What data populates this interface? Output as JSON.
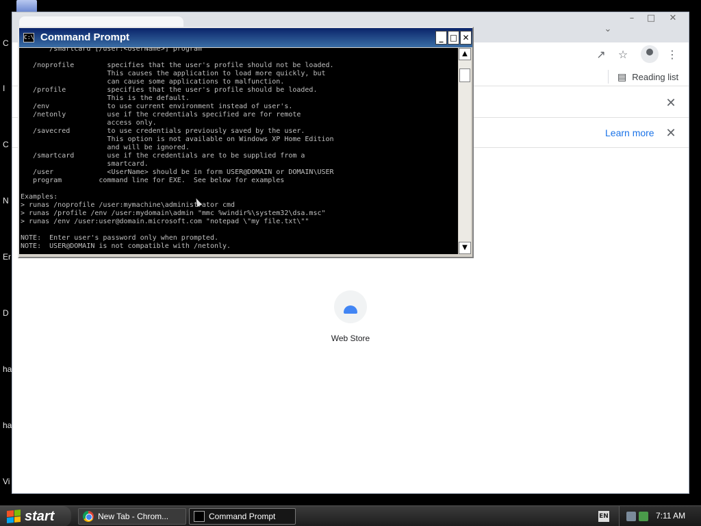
{
  "desktop": {
    "side_letters": [
      "C",
      "I",
      "C",
      "N",
      "Er",
      "D",
      "ha",
      "ha",
      "Vi"
    ]
  },
  "chrome": {
    "reading_list_label": "Reading list",
    "learn_more_label": "Learn more",
    "shortcut_label": "Web Store"
  },
  "cmd": {
    "title": "Command Prompt",
    "sys_icon": "C:\\",
    "lines": [
      "       /smartcard [/user:<UserName>] program",
      "",
      "   /noprofile        specifies that the user's profile should not be loaded.",
      "                     This causes the application to load more quickly, but",
      "                     can cause some applications to malfunction.",
      "   /profile          specifies that the user's profile should be loaded.",
      "                     This is the default.",
      "   /env              to use current environment instead of user's.",
      "   /netonly          use if the credentials specified are for remote",
      "                     access only.",
      "   /savecred         to use credentials previously saved by the user.",
      "                     This option is not available on Windows XP Home Edition",
      "                     and will be ignored.",
      "   /smartcard        use if the credentials are to be supplied from a",
      "                     smartcard.",
      "   /user             <UserName> should be in form USER@DOMAIN or DOMAIN\\USER",
      "   program         command line for EXE.  See below for examples",
      "",
      "Examples:",
      "> runas /noprofile /user:mymachine\\administrator cmd",
      "> runas /profile /env /user:mydomain\\admin \"mmc %windir%\\system32\\dsa.msc\"",
      "> runas /env /user:user@domain.microsoft.com \"notepad \\\"my file.txt\\\"\"",
      "",
      "NOTE:  Enter user's password only when prompted.",
      "NOTE:  USER@DOMAIN is not compatible with /netonly."
    ]
  },
  "taskbar": {
    "start_label": "start",
    "tasks": [
      {
        "label": "New Tab - Chrom...",
        "icon": "chrome-icon",
        "active": false
      },
      {
        "label": "Command Prompt",
        "icon": "cmd-icon",
        "active": true
      }
    ],
    "lang": "EN",
    "clock": "7:11 AM"
  },
  "colors": {
    "cmd_title_active": "#0a246a",
    "chrome_link": "#1a73e8",
    "start_logo": [
      "#f35325",
      "#81bc06",
      "#05a6f0",
      "#ffba08"
    ]
  }
}
